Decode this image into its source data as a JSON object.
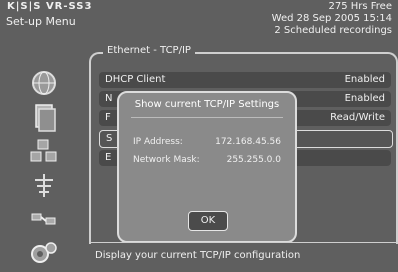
{
  "header": {
    "brand": "K|S|S VR-SS3",
    "subtitle": "Set-up Menu",
    "hrs_free": "275 Hrs Free",
    "datetime": "Wed 28 Sep 2005 15:14",
    "scheduled": "2 Scheduled recordings"
  },
  "panel": {
    "title": "Ethernet - TCP/IP",
    "rows": [
      {
        "label": "DHCP Client",
        "value": "Enabled"
      },
      {
        "label": "N",
        "value": "Enabled"
      },
      {
        "label": "F",
        "value": "Read/Write"
      },
      {
        "label": "S",
        "value": ""
      },
      {
        "label": "E",
        "value": ""
      }
    ]
  },
  "dialog": {
    "title": "Show current TCP/IP Settings",
    "ip_label": "IP Address:",
    "ip_value": "172.168.45.56",
    "mask_label": "Network Mask:",
    "mask_value": "255.255.0.0",
    "ok_label": "OK"
  },
  "footer": {
    "text": "Display your current TCP/IP configuration"
  },
  "sidebar": {
    "icons": [
      "globe-icon",
      "document-icon",
      "network-icon",
      "antenna-icon",
      "link-icon",
      "gears-icon"
    ]
  }
}
